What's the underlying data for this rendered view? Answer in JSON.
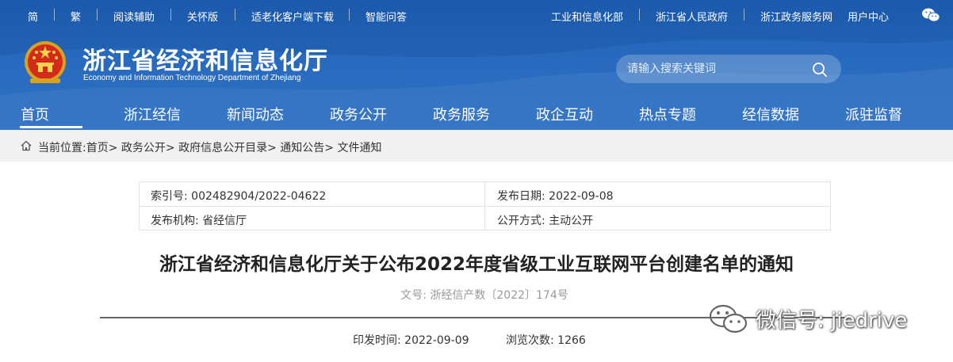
{
  "topbar": {
    "left": [
      "简",
      "繁",
      "阅读辅助",
      "关怀版",
      "适老化客户端下载",
      "智能问答"
    ],
    "right": [
      "工业和信息化部",
      "浙江省人民政府",
      "浙江政务服务网",
      "用户中心"
    ]
  },
  "site": {
    "title": "浙江省经济和信息化厅",
    "subtitle": "Economy and Information Technology Department of Zhejiang"
  },
  "search": {
    "placeholder": "请输入搜索关键词"
  },
  "nav": [
    "首页",
    "浙江经信",
    "新闻动态",
    "政务公开",
    "政务服务",
    "政企互动",
    "热点专题",
    "经信数据",
    "派驻监督"
  ],
  "breadcrumb": {
    "prefix": "当前位置:",
    "items": [
      "首页",
      "政务公开",
      "政府信息公开目录",
      "通知公告",
      "文件通知"
    ]
  },
  "meta": {
    "index_no": "索引号: 002482904/2022-04622",
    "publish_date": "发布日期: 2022-09-08",
    "publisher": "发布机构: 省经信厅",
    "disclosure": "公开方式: 主动公开"
  },
  "document": {
    "title": "浙江省经济和信息化厅关于公布2022年度省级工业互联网平台创建名单的通知",
    "doc_no": "文号: 浙经信产数〔2022〕174号",
    "issue_time": "印发时间:  2022-09-09",
    "views": "浏览次数:  1266"
  },
  "watermark": {
    "text": "微信号: jiedrive"
  },
  "colors": {
    "header_blue": "#2a6dc0",
    "crumb_bg": "#f1f1f1"
  }
}
